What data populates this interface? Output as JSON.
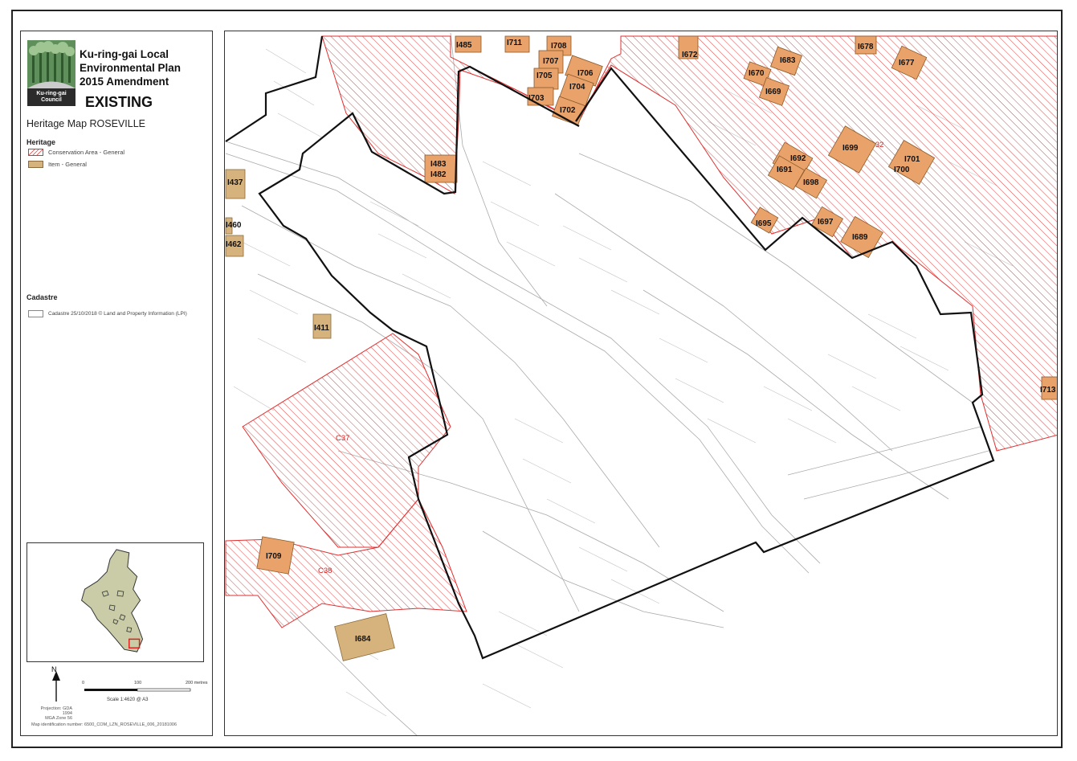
{
  "legend": {
    "title": "Ku-ring-gai Local\nEnvironmental Plan\n2015 Amendment",
    "status": "EXISTING",
    "map_name": "Heritage Map ROSEVILLE",
    "logo_text_1": "Ku-ring-gai",
    "logo_text_2": "Council",
    "heritage_heading": "Heritage",
    "conservation_label": "Conservation Area - General",
    "item_label": "Item - General",
    "cadastre_heading": "Cadastre",
    "cadastre_label": "Cadastre 25/10/2018 © Land and Property Information (LPI)",
    "north_label": "N",
    "projection": "Projection: GDA 1994\nMGA Zone 56",
    "scale_ticks": [
      "0",
      "100",
      "200 metres"
    ],
    "scale_text": "Scale  1:4620  @ A3",
    "map_id": "Map identification number:  6500_COM_LZN_ROSEVILLE_006_20181006",
    "colors": {
      "conservation_hatch": "#e03030",
      "item_fill": "#d6b27c",
      "item_fill_in_area": "#e8a26a",
      "boundary": "#111111"
    }
  },
  "map": {
    "conservation_areas": [
      "C32",
      "C32",
      "C37",
      "C38"
    ],
    "items": [
      "I485",
      "I711",
      "I708",
      "I707",
      "I706",
      "I705",
      "I704",
      "I703",
      "I702",
      "I672",
      "I683",
      "I670",
      "I669",
      "I678",
      "I677",
      "I699",
      "I692",
      "I691",
      "I698",
      "I701",
      "I700",
      "I695",
      "I697",
      "I689",
      "I483",
      "I482",
      "I437",
      "I460",
      "I462",
      "I411",
      "I713",
      "I709",
      "I684"
    ]
  }
}
